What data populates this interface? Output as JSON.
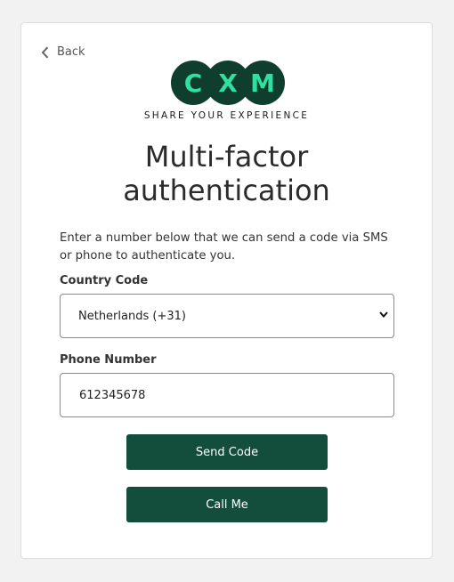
{
  "nav": {
    "back_label": "Back"
  },
  "logo": {
    "letters": [
      "C",
      "X",
      "M"
    ],
    "tagline": "SHARE YOUR EXPERIENCE"
  },
  "page": {
    "title": "Multi-factor authentication",
    "description": "Enter a number below that we can send a code via SMS or phone to authenticate you."
  },
  "form": {
    "country_label": "Country Code",
    "country_selected": "Netherlands (+31)",
    "phone_label": "Phone Number",
    "phone_value": "612345678"
  },
  "actions": {
    "send_label": "Send Code",
    "call_label": "Call Me"
  },
  "colors": {
    "brand_dark": "#134e3c",
    "logo_dark": "#0f3d2e",
    "logo_accent": "#2fe0a0"
  }
}
